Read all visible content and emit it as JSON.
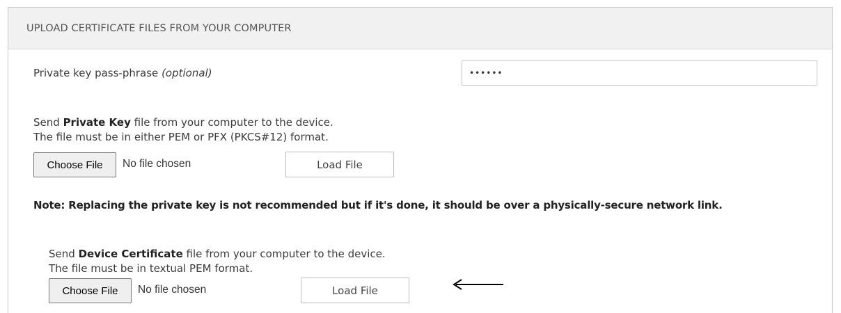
{
  "header": {
    "title": "UPLOAD CERTIFICATE FILES FROM YOUR COMPUTER"
  },
  "passphrase": {
    "label": "Private key pass-phrase",
    "label_suffix": "(optional)",
    "value": "••••••"
  },
  "private_key": {
    "line1_pre": "Send",
    "line1_bold": "Private Key",
    "line1_post": "file from your computer to the device.",
    "line2": "The file must be in either PEM or PFX (PKCS#12) format.",
    "choose_label": "Choose File",
    "no_file_label": "No file chosen",
    "load_label": "Load File"
  },
  "note": "Note: Replacing the private key is not recommended but if it's done, it should be over a physically-secure network link.",
  "device_cert": {
    "line1_pre": "Send",
    "line1_bold": "Device Certificate",
    "line1_post": "file from your computer to the device.",
    "line2": "The file must be in textual PEM format.",
    "choose_label": "Choose File",
    "no_file_label": "No file chosen",
    "load_label": "Load File"
  },
  "annotation": {
    "arrow_icon": "left-arrow-icon"
  }
}
